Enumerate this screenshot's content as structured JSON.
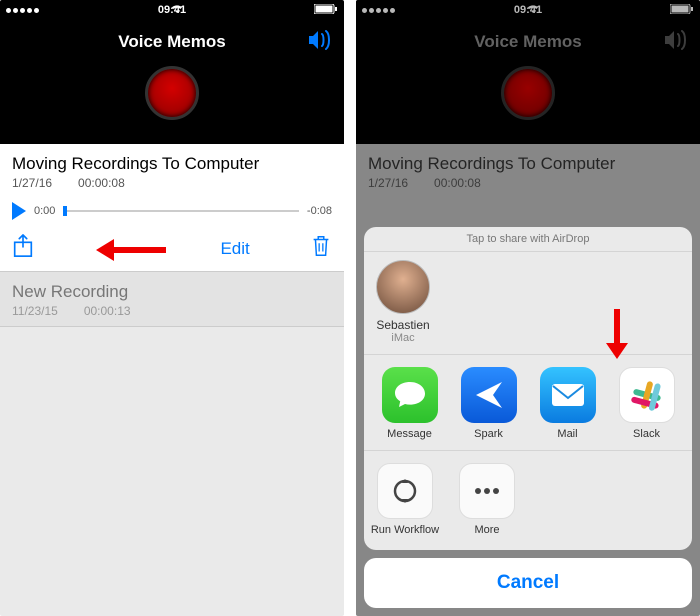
{
  "status": {
    "time": "09:41"
  },
  "nav": {
    "title": "Voice Memos"
  },
  "left": {
    "recording": {
      "title": "Moving Recordings To Computer",
      "date": "1/27/16",
      "duration": "00:00:08",
      "elapsed": "0:00",
      "remaining": "-0:08"
    },
    "edit_label": "Edit",
    "other": {
      "title": "New Recording",
      "date": "11/23/15",
      "duration": "00:00:13"
    }
  },
  "right": {
    "recording": {
      "title": "Moving Recordings To Computer",
      "date": "1/27/16",
      "duration": "00:00:08"
    },
    "sheet": {
      "airdrop_header": "Tap to share with AirDrop",
      "airdrop_contact": {
        "name": "Sebastien",
        "device": "iMac"
      },
      "apps": [
        {
          "label": "Message"
        },
        {
          "label": "Spark"
        },
        {
          "label": "Mail"
        },
        {
          "label": "Slack"
        }
      ],
      "actions": [
        {
          "label": "Run Workflow"
        },
        {
          "label": "More"
        }
      ],
      "cancel_label": "Cancel"
    }
  }
}
